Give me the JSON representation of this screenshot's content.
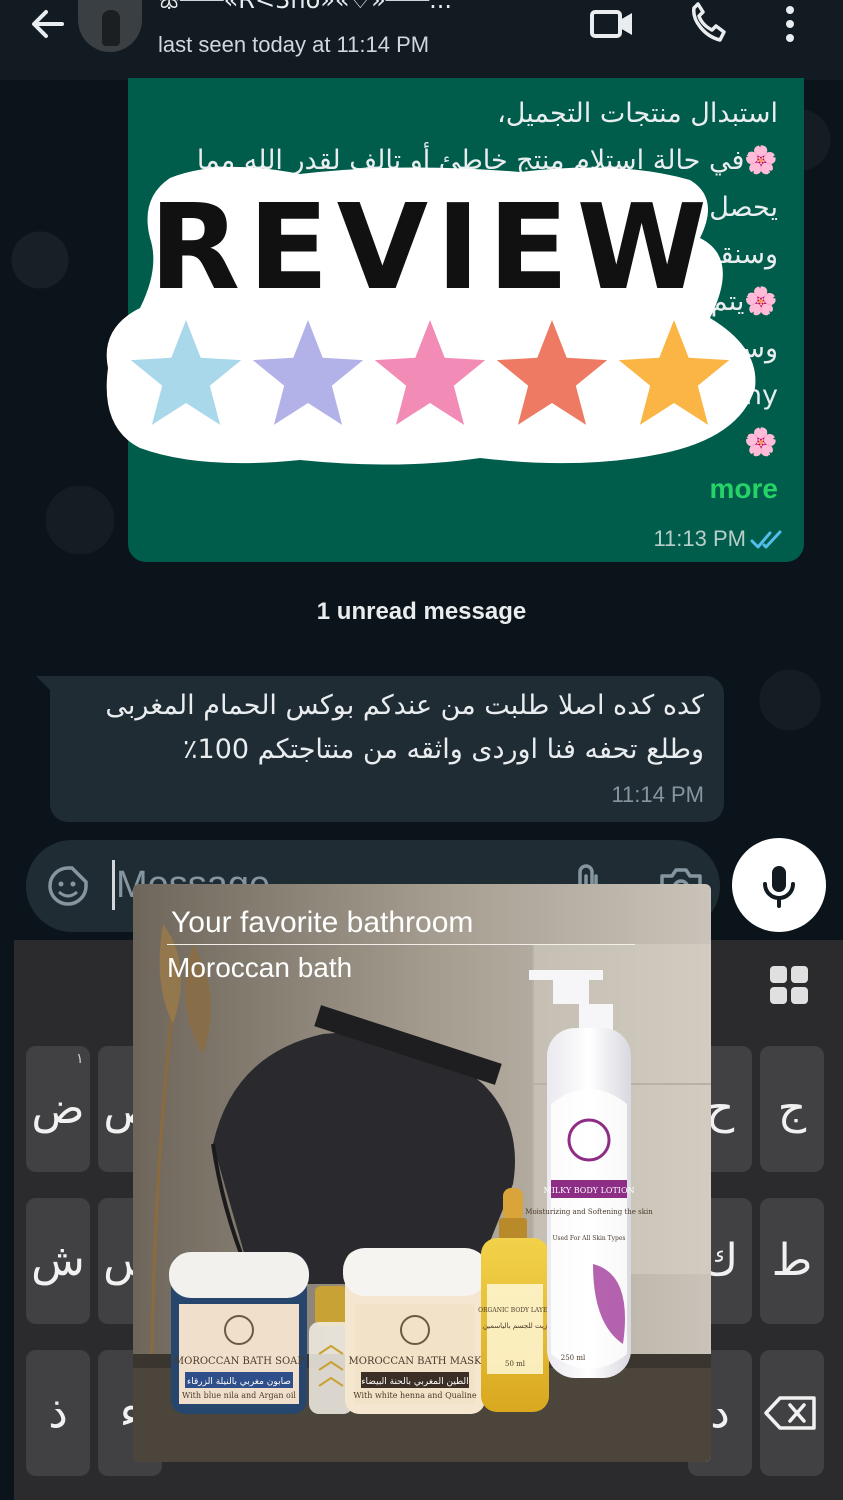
{
  "header": {
    "contact_name": "ꕥ───«R<3ho»«♡»───...",
    "status": "last seen today at 11:14 PM",
    "icons": [
      "back-arrow-icon",
      "video-call-icon",
      "phone-icon",
      "more-vert-icon"
    ]
  },
  "outgoing_message": {
    "lines": [
      "استبدال منتجات التجميل،",
      "🌸في حالة استلام منتج خاطئ أو تالف لقدر الله مما",
      "يحصل",
      "وسنقوم",
      "🌸يتم",
      "وس",
      "ny",
      "🌸"
    ],
    "more_label": "more",
    "time": "11:13 PM",
    "read_status": "read"
  },
  "sticker": {
    "text": "REVIEW",
    "star_colors": [
      "#a9d8ea",
      "#b3b2e8",
      "#f28bb5",
      "#ee7a63",
      "#fbb545"
    ]
  },
  "unread_divider": "1 unread message",
  "incoming_message": {
    "lines": [
      "كده كده اصلا طلبت من عندكم بوكس الحمام المغربى",
      "وطلع تحفه فنا اوردى واثقه من منتاجتكم 100٪"
    ],
    "time": "11:14 PM"
  },
  "composer": {
    "placeholder": "Message",
    "icons": [
      "emoji-icon",
      "attach-icon",
      "camera-icon",
      "mic-icon"
    ]
  },
  "keyboard": {
    "keys": [
      {
        "label": "ض",
        "hint": "١"
      },
      {
        "label": "ص",
        "hint": ""
      },
      {
        "label": "ح",
        "hint": ""
      },
      {
        "label": "ج",
        "hint": ""
      },
      {
        "label": "ش",
        "hint": ""
      },
      {
        "label": "س",
        "hint": ""
      },
      {
        "label": "ك",
        "hint": ""
      },
      {
        "label": "ط",
        "hint": ""
      },
      {
        "label": "ذ",
        "hint": ""
      },
      {
        "label": "ء",
        "hint": ""
      },
      {
        "label": "د",
        "hint": ""
      }
    ]
  },
  "ad": {
    "title": "Your favorite bathroom",
    "subtitle": "Moroccan bath",
    "products": {
      "soap": "MOROCCAN BATH SOAP",
      "soap_arabic": "صابون مغربي بالنيلة الزرقاء",
      "soap_sub": "With blue nila and Argan oil",
      "mask": "MOROCCAN BATH MASK",
      "mask_arabic": "الطين المغربي بالحنة البيضاء",
      "mask_sub": "With white henna and Qualine",
      "lotion": "MILKY BODY LOTION",
      "lotion_sub": "Moisturizing and Softening the skin",
      "lotion_types": "Used For All Skin Types",
      "lotion_volume": "250 ml",
      "oil": "ORGANIC BODY LAYER",
      "oil_arabic": "زيت للجسم بالياسمين",
      "oil_volume": "50 ml"
    }
  }
}
